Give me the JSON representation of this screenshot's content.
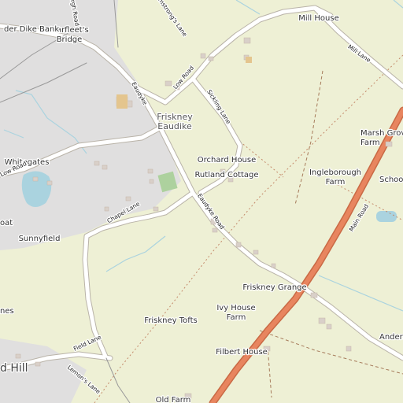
{
  "colors": {
    "background_farmland": "#eef0d5",
    "residential": "#e0dfdf",
    "minor_road": "#ffffff",
    "road_casing": "#b9b3a8",
    "main_road": "#e8855f",
    "water": "#aad3df",
    "green_patch": "#add19e",
    "boundary": "#c48a6b"
  },
  "labels": {
    "marfleets_bridge": "Marfleet's\nBridge",
    "dike_bank": "der Dike Bank",
    "burgh_road": "Burgh Road",
    "armstrongs_lane": "Armstrong's Lane",
    "mill_house": "Mill House",
    "mill_lane": "Mill Lane",
    "low_road_north": "Low Road",
    "eaudyke_north": "Eaudyke",
    "sickling_lane": "Sickling Lane",
    "friskney_eaudike": "Friskney\nEaudike",
    "marsh_grove_farm": "Marsh Grove\nFarm",
    "school": "School",
    "whitegates": "Whitegates",
    "low_road_west": "Low Road",
    "orchard_house": "Orchard House",
    "rutland_cottage": "Rutland Cottage",
    "ingleborough_farm": "Ingleborough\nFarm",
    "chapel_lane": "Chapel Lane",
    "eaudyke_road": "Eaudyke Road",
    "main_road": "Main Road",
    "sunnyfield": "Sunnyfield",
    "oat": "oat",
    "friskney_grange": "Friskney Grange",
    "nes": "nes",
    "friskney_tofts": "Friskney Tofts",
    "ivy_house_farm": "Ivy House\nFarm",
    "field_lane": "Field Lane",
    "filbert_house": "Filbert House",
    "anders": "Anders",
    "lemons_lane": "Lemon's Lane",
    "d_hill": "d Hill",
    "old_farm": "Old Farm"
  }
}
